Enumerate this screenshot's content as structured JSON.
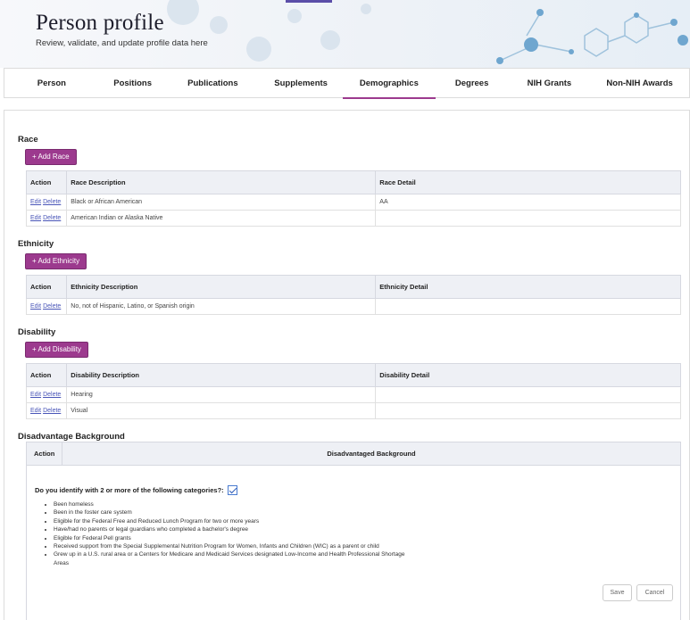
{
  "header": {
    "title": "Person profile",
    "subtitle": "Review, validate, and update profile data here"
  },
  "tabs": [
    {
      "label": "Person"
    },
    {
      "label": "Positions"
    },
    {
      "label": "Publications"
    },
    {
      "label": "Supplements"
    },
    {
      "label": "Demographics",
      "active": true
    },
    {
      "label": "Degrees"
    },
    {
      "label": "NIH Grants"
    },
    {
      "label": "Non-NIH Awards"
    }
  ],
  "race": {
    "title": "Race",
    "add_label": "+ Add Race",
    "columns": [
      "Action",
      "Race Description",
      "Race Detail"
    ],
    "rows": [
      {
        "description": "Black or African American",
        "detail": "AA"
      },
      {
        "description": "American Indian or Alaska Native",
        "detail": ""
      }
    ]
  },
  "ethnicity": {
    "title": "Ethnicity",
    "add_label": "+ Add Ethnicity",
    "columns": [
      "Action",
      "Ethnicity Description",
      "Ethnicity Detail"
    ],
    "rows": [
      {
        "description": "No, not of Hispanic, Latino, or Spanish origin",
        "detail": ""
      }
    ]
  },
  "disability": {
    "title": "Disability",
    "add_label": "+ Add Disability",
    "columns": [
      "Action",
      "Disability Description",
      "Disability Detail"
    ],
    "rows": [
      {
        "description": "Hearing",
        "detail": ""
      },
      {
        "description": "Visual",
        "detail": ""
      }
    ]
  },
  "row_actions": {
    "edit": "Edit",
    "delete": "Delete"
  },
  "disadvantage": {
    "title": "Disadvantage Background",
    "col_action": "Action",
    "col_main": "Disadvantaged Background",
    "question": "Do you identify with 2 or more of the following categories?:",
    "checked": true,
    "categories": [
      "Been homeless",
      "Been in the foster care system",
      "Eligible for the Federal Free and Reduced Lunch Program for two or more years",
      "Have/had no parents or legal guardians who completed a bachelor's degree",
      "Eligible for Federal Pell grants",
      "Received support from the Special Supplemental Nutrition Program for Women, Infants and Children (WIC) as a parent or child",
      "Grew up in a U.S. rural area or a Centers for Medicare and Medicaid Services designated Low-Income and Health Professional Shortage Areas"
    ],
    "save_label": "Save",
    "cancel_label": "Cancel"
  },
  "colors": {
    "accent": "#9c3a8e",
    "link": "#4a56b8",
    "table_header": "#eef0f5"
  }
}
